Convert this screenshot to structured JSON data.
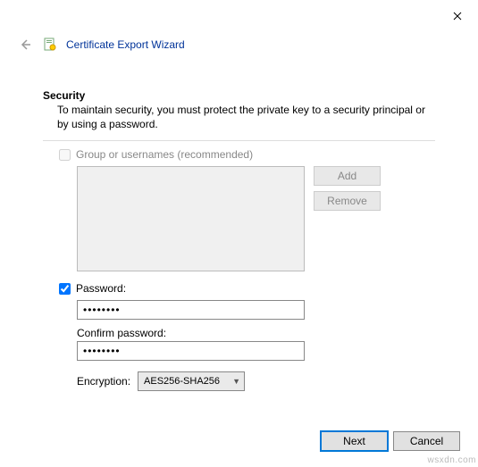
{
  "window": {
    "title": "Certificate Export Wizard"
  },
  "section": {
    "heading": "Security",
    "subheading": "To maintain security, you must protect the private key to a security principal or by using a password."
  },
  "groupUsers": {
    "checkbox_label": "Group or usernames (recommended)",
    "checked": false,
    "add_label": "Add",
    "remove_label": "Remove"
  },
  "password": {
    "checkbox_label": "Password:",
    "checked": true,
    "value_mask": "••••••••",
    "confirm_label": "Confirm password:",
    "confirm_mask": "••••••••"
  },
  "encryption": {
    "label": "Encryption:",
    "selected": "AES256-SHA256"
  },
  "buttons": {
    "next": "Next",
    "cancel": "Cancel"
  },
  "watermark": "wsxdn.com"
}
